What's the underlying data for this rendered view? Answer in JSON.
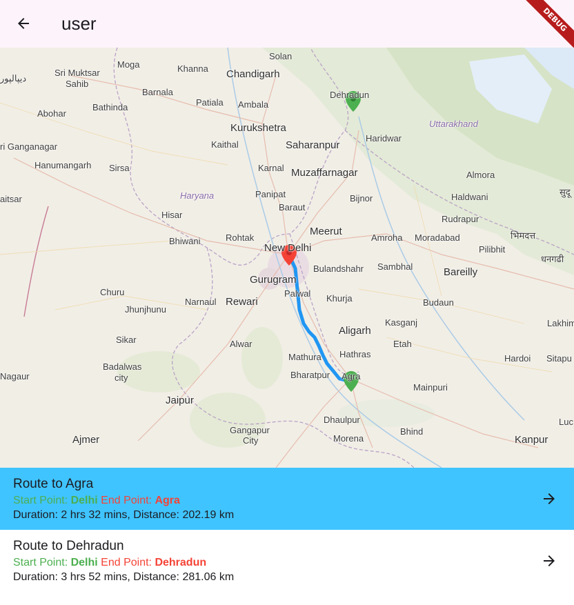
{
  "appbar": {
    "title": "user",
    "back_icon": "arrow-back-icon"
  },
  "debug_banner": "DEBUG",
  "map": {
    "labels": {
      "solan": "Solan",
      "moga": "Moga",
      "khanna": "Khanna",
      "chandigarh": "Chandigarh",
      "dehradun": "Dehradun",
      "muktsar": "Sri Muktsar",
      "sahib": "Sahib",
      "barnala": "Barnala",
      "patiala": "Patiala",
      "ambala": "Ambala",
      "abohar": "Abohar",
      "bathinda": "Bathinda",
      "uttarakhand": "Uttarakhand",
      "kurukshetra": "Kurukshetra",
      "haridwar": "Haridwar",
      "ganganagar": "ri Ganganagar",
      "kaithal": "Kaithal",
      "saharanpur": "Saharanpur",
      "hanumangarh": "Hanumangarh",
      "sirsa": "Sirsa",
      "karnal": "Karnal",
      "muzaffarnagar": "Muzaffarnagar",
      "almora": "Almora",
      "aitsar": "aitsar",
      "haryana": "Haryana",
      "panipat": "Panipat",
      "bijnor": "Bijnor",
      "haldwani": "Haldwani",
      "baraut": "Baraut",
      "hisar": "Hisar",
      "rudrapur": "Rudrapur",
      "meerut": "Meerut",
      "bhiwani": "Bhiwani",
      "rohtak": "Rohtak",
      "new_delhi": "New Delhi",
      "amroha": "Amroha",
      "moradabad": "Moradabad",
      "pilibhit": "Pilibhit",
      "bulandshahr": "Bulandshahr",
      "sambhal": "Sambhal",
      "bareilly": "Bareilly",
      "gurugram": "Gurugram",
      "palwal": "Palwal",
      "khurja": "Khurja",
      "churu": "Churu",
      "narnaul": "Narnaul",
      "rewari": "Rewari",
      "budaun": "Budaun",
      "jhunjhunu": "Jhunjhunu",
      "aligarh": "Aligarh",
      "kasganj": "Kasganj",
      "lakhimpur": "Lakhim",
      "alwar": "Alwar",
      "etah": "Etah",
      "sikar": "Sikar",
      "mathura": "Mathura",
      "hathras": "Hathras",
      "hardoi": "Hardoi",
      "sitapur": "Sitapu",
      "nagaur": "Nagaur",
      "badalwas": "Badalwas",
      "city": "city",
      "bharatpur": "Bharatpur",
      "agra": "Agra",
      "mainpuri": "Mainpuri",
      "jaipur": "Jaipur",
      "dhaulpur": "Dhaulpur",
      "luc": "Luc",
      "gangapur": "Gangapur",
      "gangapur_city": "City",
      "bhind": "Bhind",
      "ajmer": "Ajmer",
      "morena": "Morena",
      "kanpur": "Kanpur",
      "urdu_left": "دیپالپور",
      "hindi_right": "भिमदत्त",
      "hindi_right2": "धनगढी",
      "hindi_edge": "सुदू"
    }
  },
  "routes": [
    {
      "title": "Route to Agra",
      "start_label": "Start Point: ",
      "start_value": "Delhi",
      "end_label": " End Point: ",
      "end_value": "Agra",
      "info": "Duration: 2 hrs 32 mins, Distance: 202.19 km",
      "selected": true
    },
    {
      "title": "Route to Dehradun",
      "start_label": "Start Point: ",
      "start_value": "Delhi",
      "end_label": " End Point: ",
      "end_value": "Dehradun",
      "info": "Duration: 3 hrs 52 mins, Distance: 281.06 km",
      "selected": false
    }
  ],
  "colors": {
    "selected_row": "#40c4ff",
    "start": "#4caf50",
    "end": "#f44336",
    "route_line": "#2196f3",
    "appbar": "#fdf4fb"
  }
}
